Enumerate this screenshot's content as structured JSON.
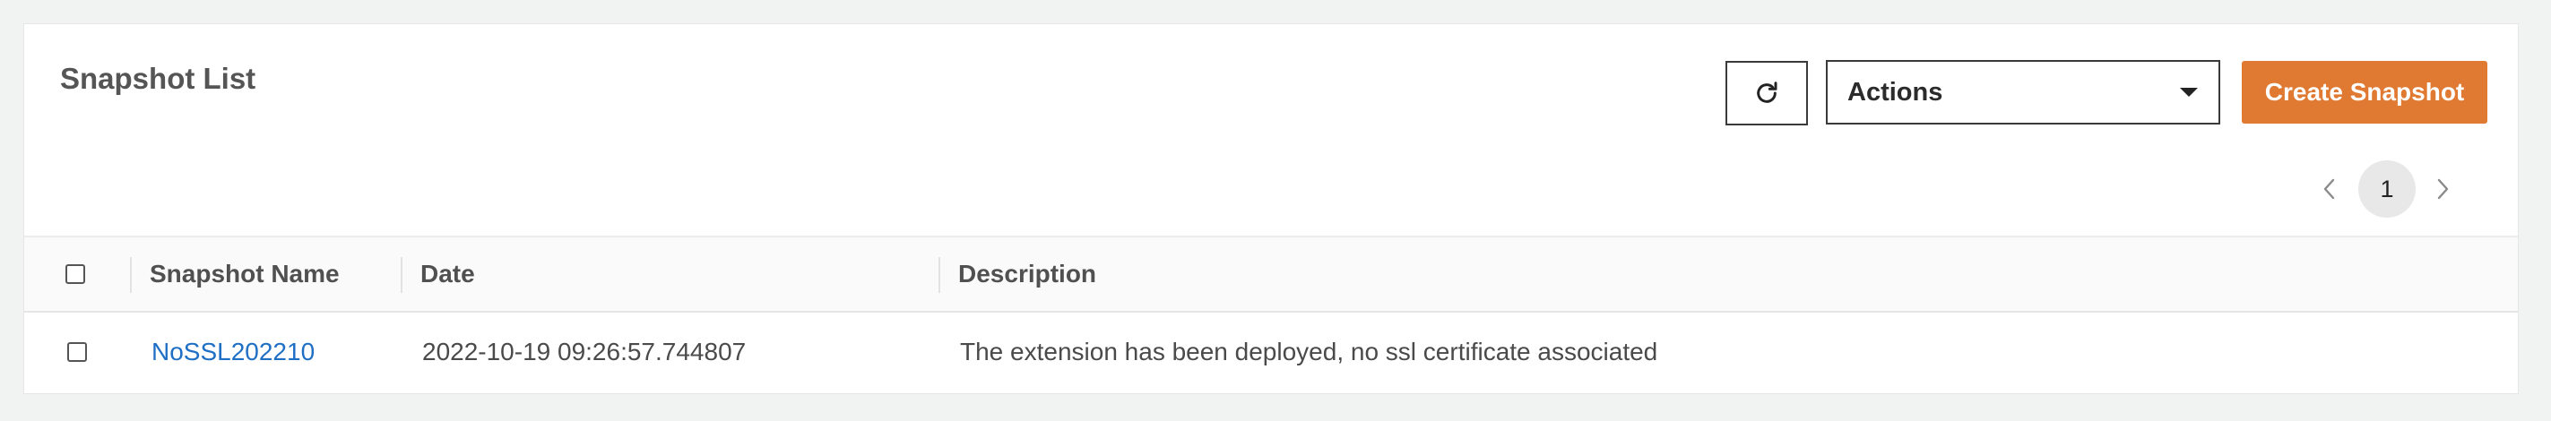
{
  "header": {
    "title": "Snapshot List",
    "actions_label": "Actions",
    "create_label": "Create Snapshot"
  },
  "pagination": {
    "current_page": "1"
  },
  "table": {
    "columns": [
      "Snapshot Name",
      "Date",
      "Description"
    ],
    "rows": [
      {
        "name": "NoSSL202210",
        "date": "2022-10-19 09:26:57.744807",
        "description": "The extension has been deployed, no ssl certificate associated"
      }
    ]
  },
  "icons": {
    "refresh": "refresh-icon",
    "dropdown": "caret-down-icon",
    "prev": "chevron-left-icon",
    "next": "chevron-right-icon"
  },
  "colors": {
    "accent": "#e07a32",
    "link": "#1f6fc5",
    "background": "#f1f2f2"
  }
}
